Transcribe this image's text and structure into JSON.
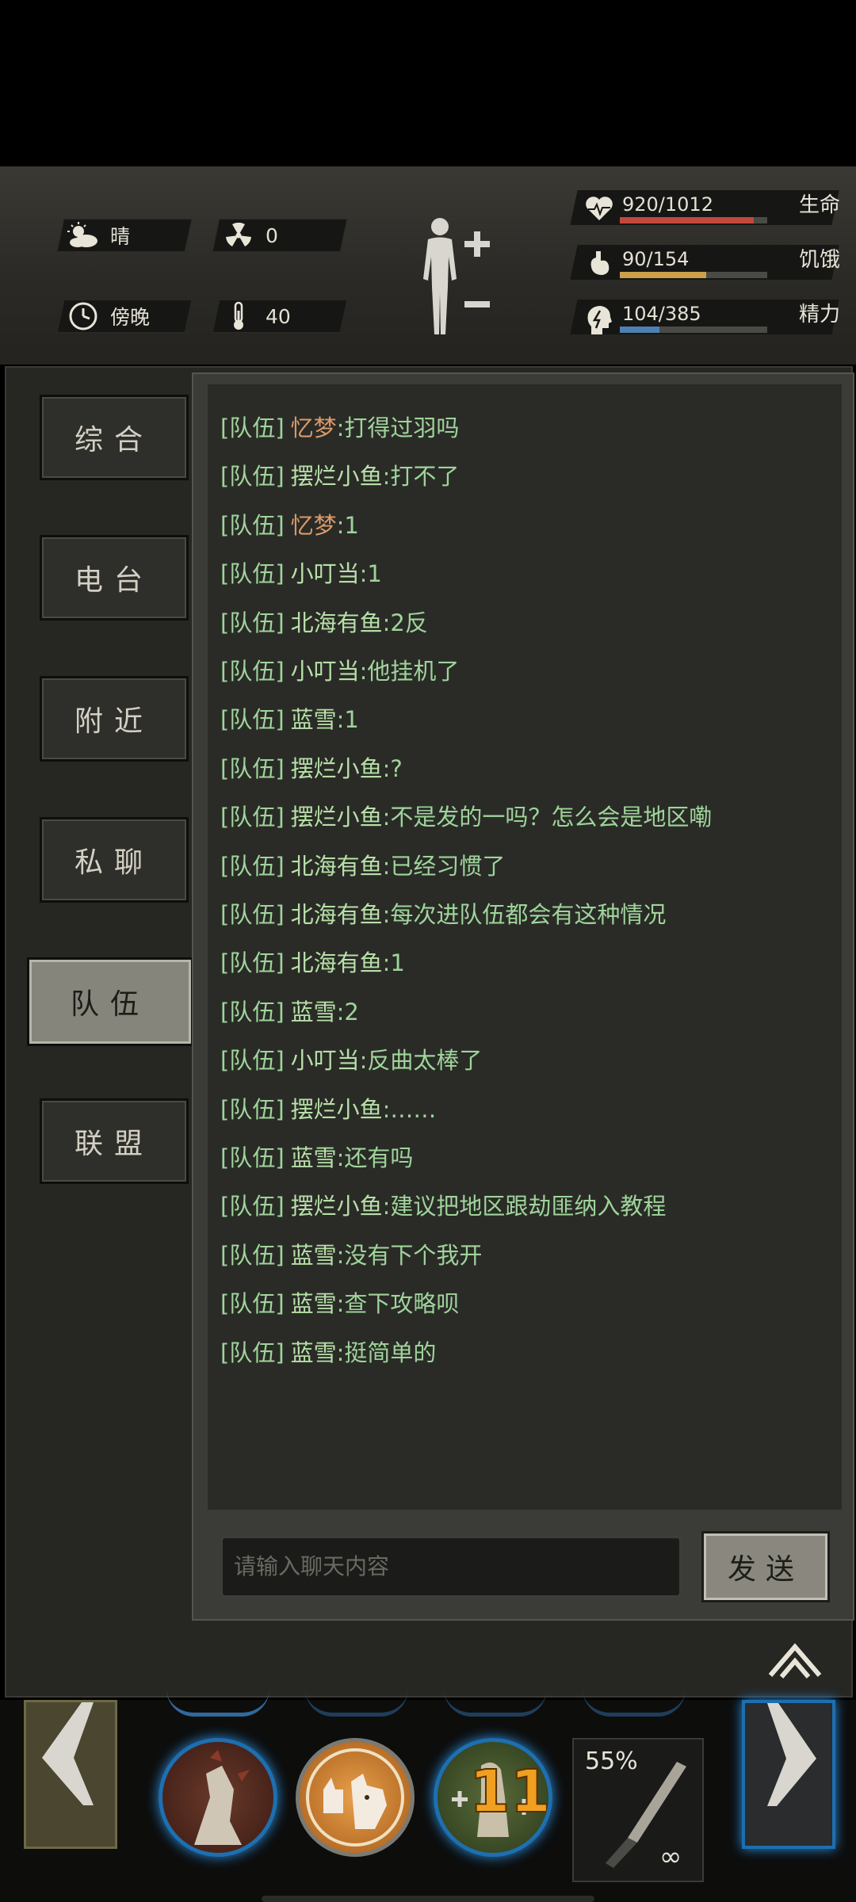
{
  "status": {
    "weather": "晴",
    "radiation": "0",
    "time_of_day": "傍晚",
    "temperature": "40"
  },
  "stats": [
    {
      "label": "生命",
      "value": "920/1012",
      "fill": 0.909,
      "color": "#c4473d",
      "icon": "heart-icon"
    },
    {
      "label": "饥饿",
      "value": "90/154",
      "fill": 0.584,
      "color": "#caa04a",
      "icon": "stomach-icon"
    },
    {
      "label": "精力",
      "value": "104/385",
      "fill": 0.27,
      "color": "#4f7fb3",
      "icon": "energy-head-icon"
    }
  ],
  "tabs": [
    "综合",
    "电台",
    "附近",
    "私聊",
    "队伍",
    "联盟"
  ],
  "active_tab": "队伍",
  "channel_tag": "[队伍]",
  "messages": [
    {
      "name": "忆梦",
      "text": ":打得过羽吗",
      "warm": true
    },
    {
      "name": "摆烂小鱼",
      "text": ":打不了",
      "warm": false
    },
    {
      "name": "忆梦",
      "text": ":1",
      "warm": true
    },
    {
      "name": "小叮当",
      "text": ":1",
      "warm": false
    },
    {
      "name": "北海有鱼",
      "text": ":2反",
      "warm": false
    },
    {
      "name": "小叮当",
      "text": ":他挂机了",
      "warm": false
    },
    {
      "name": "蓝雪",
      "text": ":1",
      "warm": false
    },
    {
      "name": "摆烂小鱼",
      "text": ":?",
      "warm": false
    },
    {
      "name": "摆烂小鱼",
      "text": ":不是发的一吗？怎么会是地区嘞",
      "warm": false
    },
    {
      "name": "北海有鱼",
      "text": ":已经习惯了",
      "warm": false
    },
    {
      "name": "北海有鱼",
      "text": ":每次进队伍都会有这种情况",
      "warm": false
    },
    {
      "name": "北海有鱼",
      "text": ":1",
      "warm": false
    },
    {
      "name": "蓝雪",
      "text": ":2",
      "warm": false
    },
    {
      "name": "小叮当",
      "text": ":反曲太棒了",
      "warm": false
    },
    {
      "name": "摆烂小鱼",
      "text": ":……",
      "warm": false
    },
    {
      "name": "蓝雪",
      "text": ":还有吗",
      "warm": false
    },
    {
      "name": "摆烂小鱼",
      "text": ":建议把地区跟劫匪纳入教程",
      "warm": false
    },
    {
      "name": "蓝雪",
      "text": ":没有下个我开",
      "warm": false
    },
    {
      "name": "蓝雪",
      "text": ":查下攻略呗",
      "warm": false
    },
    {
      "name": "蓝雪",
      "text": ":挺简单的",
      "warm": false
    }
  ],
  "chat_input": {
    "placeholder": "请输入聊天内容"
  },
  "send_label": "发送",
  "hotbar": {
    "weapon_durability": "55%",
    "weapon_uses": "∞",
    "skill_badge": "11"
  }
}
